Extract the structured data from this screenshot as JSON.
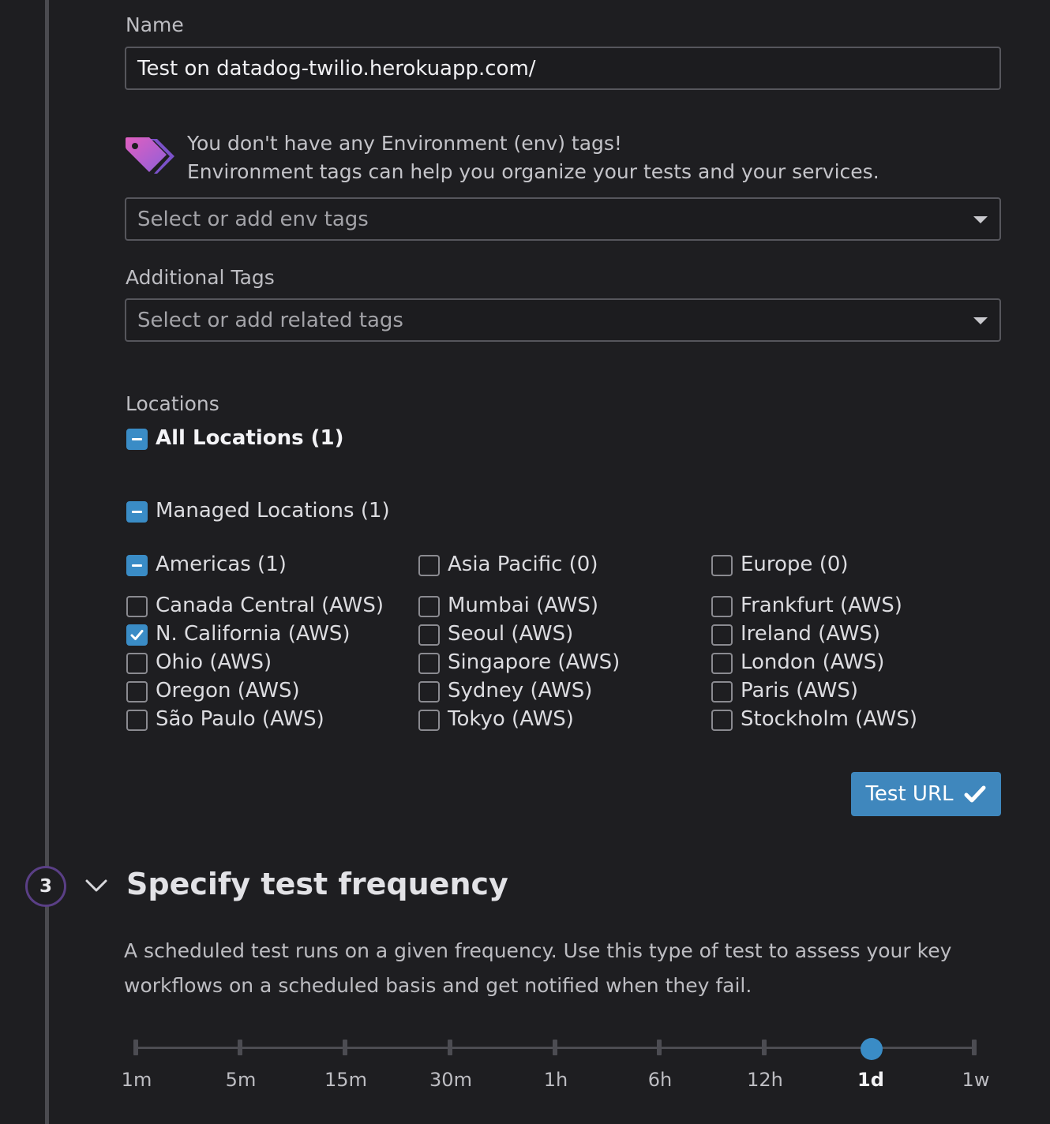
{
  "name_section": {
    "label": "Name",
    "value": "Test on datadog-twilio.herokuapp.com/"
  },
  "env_tags": {
    "icon": "tag-icon",
    "notice_line1": "You don't have any Environment (env) tags!",
    "notice_line2": "Environment tags can help you organize your tests and your services.",
    "placeholder": "Select or add env tags"
  },
  "additional_tags": {
    "label": "Additional Tags",
    "placeholder": "Select or add related tags"
  },
  "locations": {
    "label": "Locations",
    "all_label": "All Locations (1)",
    "managed_label": "Managed Locations (1)",
    "regions": [
      {
        "name": "Americas (1)",
        "state": "partial",
        "items": [
          {
            "label": "Canada Central (AWS)",
            "checked": false
          },
          {
            "label": "N. California (AWS)",
            "checked": true
          },
          {
            "label": "Ohio (AWS)",
            "checked": false
          },
          {
            "label": "Oregon (AWS)",
            "checked": false
          },
          {
            "label": "São Paulo (AWS)",
            "checked": false
          }
        ]
      },
      {
        "name": "Asia Pacific (0)",
        "state": "unchecked",
        "items": [
          {
            "label": "Mumbai (AWS)",
            "checked": false
          },
          {
            "label": "Seoul (AWS)",
            "checked": false
          },
          {
            "label": "Singapore (AWS)",
            "checked": false
          },
          {
            "label": "Sydney (AWS)",
            "checked": false
          },
          {
            "label": "Tokyo (AWS)",
            "checked": false
          }
        ]
      },
      {
        "name": "Europe (0)",
        "state": "unchecked",
        "items": [
          {
            "label": "Frankfurt (AWS)",
            "checked": false
          },
          {
            "label": "Ireland (AWS)",
            "checked": false
          },
          {
            "label": "London (AWS)",
            "checked": false
          },
          {
            "label": "Paris (AWS)",
            "checked": false
          },
          {
            "label": "Stockholm (AWS)",
            "checked": false
          }
        ]
      }
    ]
  },
  "test_button": {
    "label": "Test URL",
    "icon": "checkmark-icon"
  },
  "frequency": {
    "step_number": "3",
    "title": "Specify test frequency",
    "description": "A scheduled test runs on a given frequency. Use this type of test to assess your key workflows on a scheduled basis and get notified when they fail.",
    "options": [
      "1m",
      "5m",
      "15m",
      "30m",
      "1h",
      "6h",
      "12h",
      "1d",
      "1w"
    ],
    "selected": "1d"
  },
  "colors": {
    "accent": "#3a8cc6",
    "step_ring": "#5a3f86"
  }
}
